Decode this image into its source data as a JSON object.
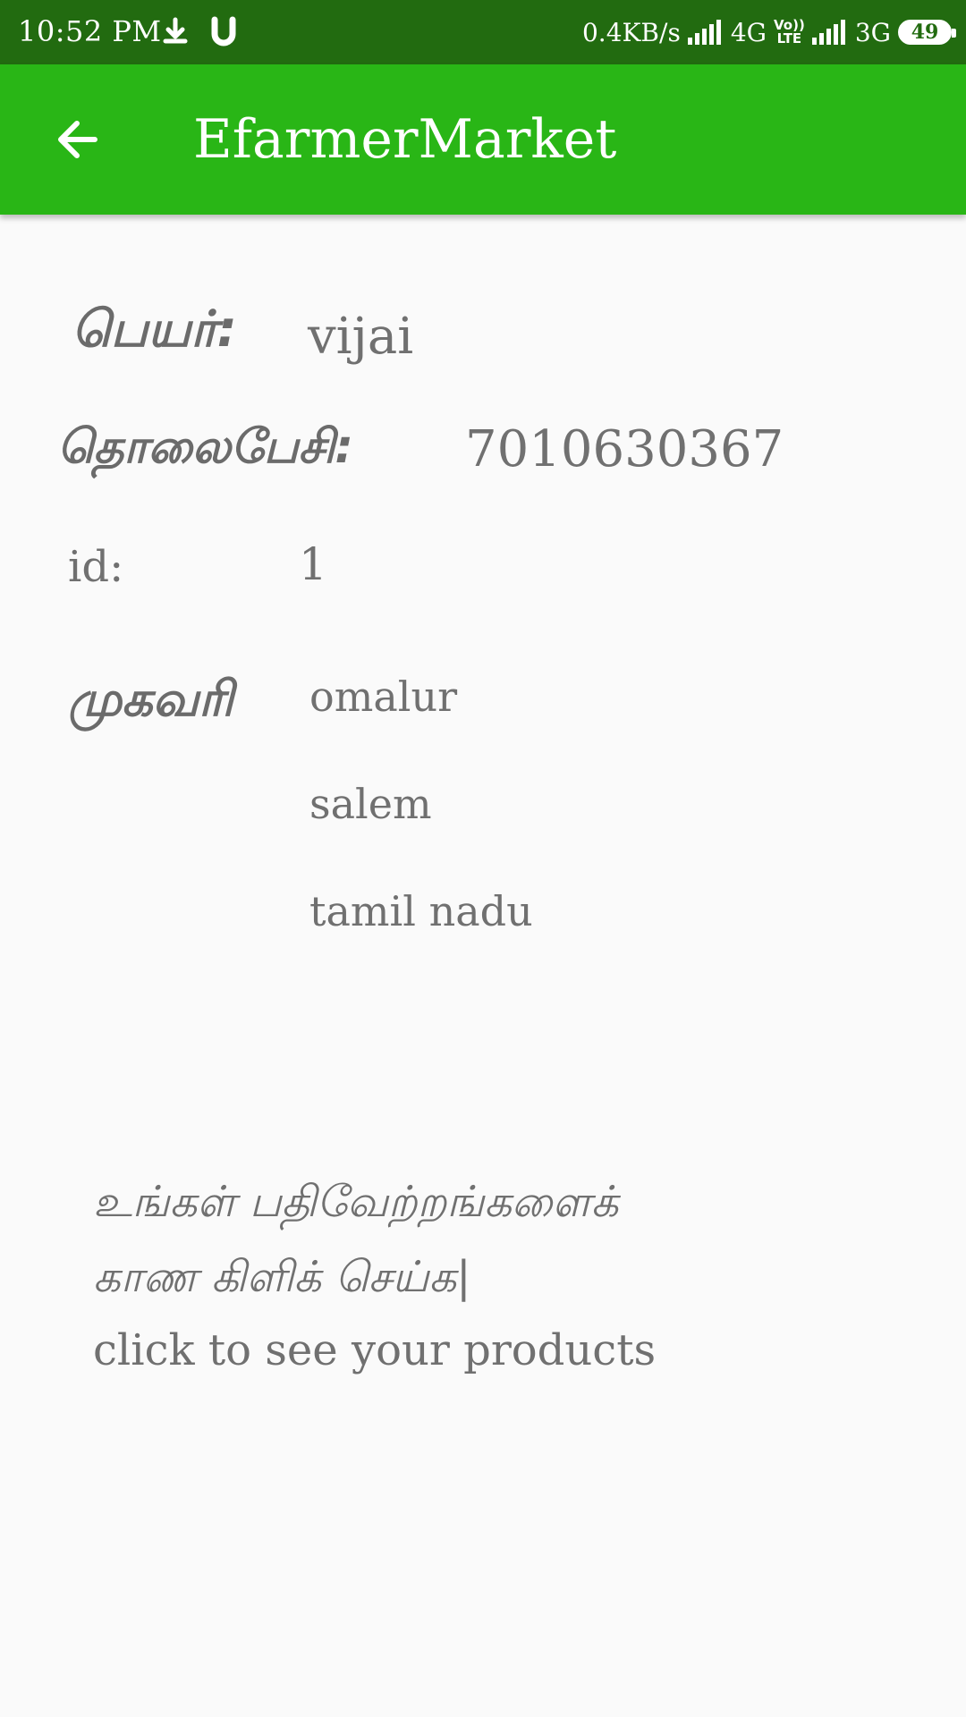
{
  "status_bar": {
    "time": "10:52 PM",
    "network_speed": "0.4KB/s",
    "network_1": "4G",
    "volte_line1": "Vo))",
    "volte_line2": "LTE",
    "network_2": "3G",
    "battery": "49",
    "icons": [
      "download-icon",
      "u-app-icon",
      "signal-icon",
      "volte-icon",
      "signal-icon",
      "battery-icon"
    ]
  },
  "app_bar": {
    "title": "EfarmerMarket",
    "back_icon": "arrow-back-icon"
  },
  "profile": {
    "name_label": "பெயர்:",
    "name_value": "vijai",
    "phone_label": "தொலைபேசி:",
    "phone_value": "7010630367",
    "id_label": "id:",
    "id_value": "1",
    "address_label": "முகவரி",
    "address_lines": [
      "omalur",
      "salem",
      "tamil nadu"
    ]
  },
  "action": {
    "tamil_line1": "உங்கள் பதிவேற்றங்களைக்",
    "tamil_line2": "காண கிளிக் செய்க|",
    "english": "click to see your products"
  },
  "colors": {
    "status_bar": "#226b10",
    "app_bar": "#29b616",
    "background": "#fafafa",
    "text": "#707070"
  }
}
